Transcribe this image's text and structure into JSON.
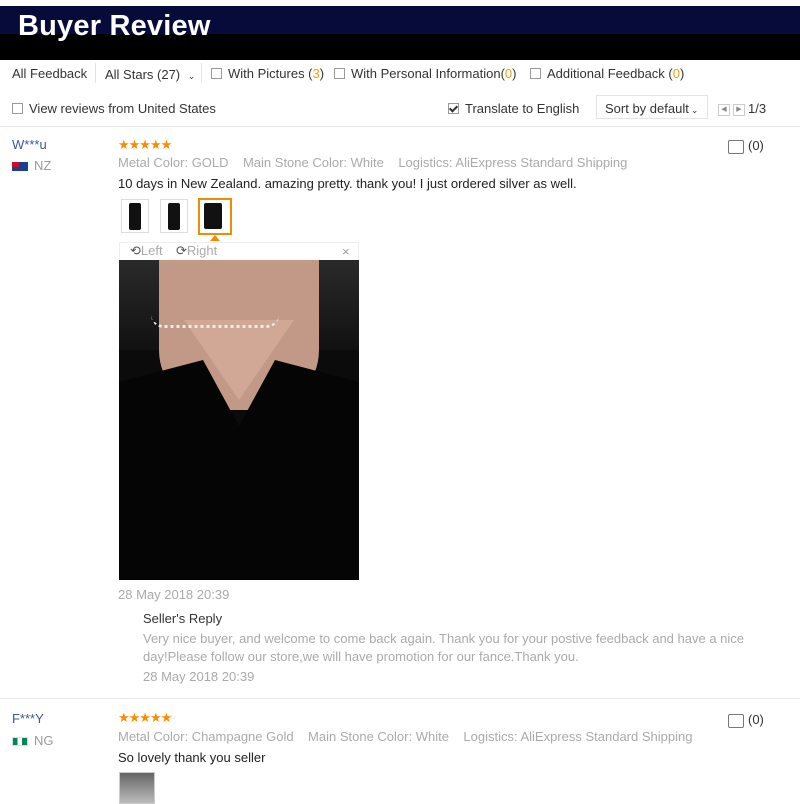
{
  "header": {
    "title": "Buyer Review"
  },
  "filters": {
    "all_feedback": "All Feedback",
    "all_stars": "All Stars (27)",
    "with_pictures": "With Pictures (",
    "with_pictures_count": "3",
    "with_personal_info": "With Personal Information(",
    "with_personal_info_count": "0",
    "additional_feedback": "Additional Feedback (",
    "additional_feedback_count": "0",
    "close_paren": ")",
    "view_us": "View reviews from United States",
    "translate": "Translate to English",
    "sort": "Sort by default",
    "page": "1/3"
  },
  "reviews": [
    {
      "user": "W***u",
      "country": "NZ",
      "stars": "★★★★★",
      "meta": "Metal Color: GOLD    Main Stone Color: White    Logistics: AliExpress Standard Shipping",
      "text": "10 days in New Zealand. amazing pretty. thank you! I just ordered silver as well.",
      "likes": "(0)",
      "rotate_left": "Left",
      "rotate_right": "Right",
      "close": "×",
      "date": "28 May 2018 20:39",
      "seller_reply_label": "Seller's Reply",
      "seller_reply_line1": "Very nice buyer, and welcome to come back again. Thank you for your postive feedback and have a nice",
      "seller_reply_line2": "day!Please follow our store,we will have promotion for our fance.Thank you.",
      "seller_reply_date": "28 May 2018 20:39"
    },
    {
      "user": "F***Y",
      "country": "NG",
      "stars": "★★★★★",
      "meta": "Metal Color: Champagne Gold    Main Stone Color: White    Logistics: AliExpress Standard Shipping",
      "text": "So lovely thank you seller",
      "likes": "(0)"
    }
  ],
  "colors": {
    "banner": "#070b3a",
    "accent": "#f39c12",
    "user": "#3b5998"
  }
}
